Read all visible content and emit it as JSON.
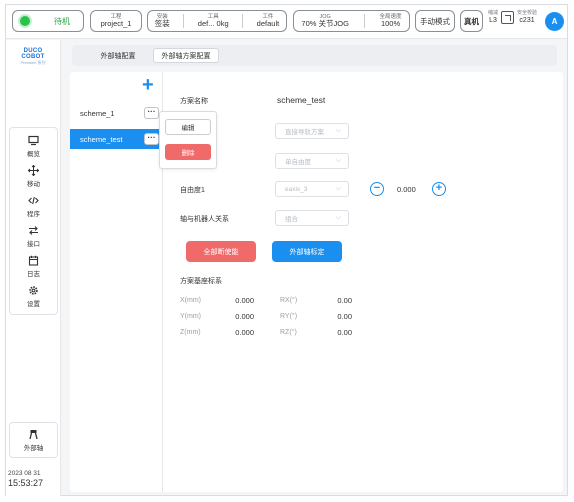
{
  "topbar": {
    "status": "待机",
    "project": {
      "label": "工程",
      "value": "project_1"
    },
    "install": {
      "label": "安装",
      "value": "签装"
    },
    "tool": {
      "label": "工具",
      "value": "def... 0kg"
    },
    "workpiece": {
      "label": "工件",
      "value": "default"
    },
    "jog": {
      "label": "JOG",
      "value": "70% 关节JOG"
    },
    "speed": {
      "label": "全局速度",
      "value": "100%"
    },
    "mode": "手动模式",
    "real": "真机",
    "reduce": {
      "label": "缩减",
      "value": "L3"
    },
    "safety": {
      "label": "安全校验",
      "value": "c231"
    },
    "avatar": "A",
    "colors": {
      "status_green": "#29c34c",
      "accent": "#1b8ff0",
      "danger": "#f06a6a"
    }
  },
  "logo": {
    "brand": "DUCO COBOT",
    "edition": "Premium 系列"
  },
  "sidebar": {
    "items": [
      {
        "icon": "monitor-icon",
        "label": "概览"
      },
      {
        "icon": "move-icon",
        "label": "移动"
      },
      {
        "icon": "code-icon",
        "label": "程序"
      },
      {
        "icon": "interface-icon",
        "label": "接口"
      },
      {
        "icon": "log-icon",
        "label": "日志"
      },
      {
        "icon": "gear-icon",
        "label": "设置"
      }
    ],
    "external": {
      "icon": "external-axis-icon",
      "label": "外部轴"
    },
    "date": "2023 08 31",
    "time": "15:53:27"
  },
  "tabs": [
    "外部轴配置",
    "外部轴方案配置"
  ],
  "schemes": {
    "add": "+",
    "items": [
      "scheme_1",
      "scheme_test"
    ],
    "more": "···",
    "menu": {
      "edit": "编辑",
      "delete": "删除"
    }
  },
  "form": {
    "name_label": "方案名称",
    "name_value": "scheme_test",
    "type_select": "直接导轨方案",
    "dof_select": "单自由度",
    "dof1_label": "自由度1",
    "dof1_select": "eaxis_3",
    "dof1_value": "0.000",
    "relation_label": "轴与机器人关系",
    "relation_select": "组合",
    "btn_reset": "全部断使能",
    "btn_calibrate": "外部轴标定",
    "base_title": "方案基座标系",
    "coords": [
      {
        "label": "X(mm)",
        "value": "0.000",
        "rlabel": "RX(°)",
        "rvalue": "0.00"
      },
      {
        "label": "Y(mm)",
        "value": "0.000",
        "rlabel": "RY(°)",
        "rvalue": "0.00"
      },
      {
        "label": "Z(mm)",
        "value": "0.000",
        "rlabel": "RZ(°)",
        "rvalue": "0.00"
      }
    ]
  }
}
